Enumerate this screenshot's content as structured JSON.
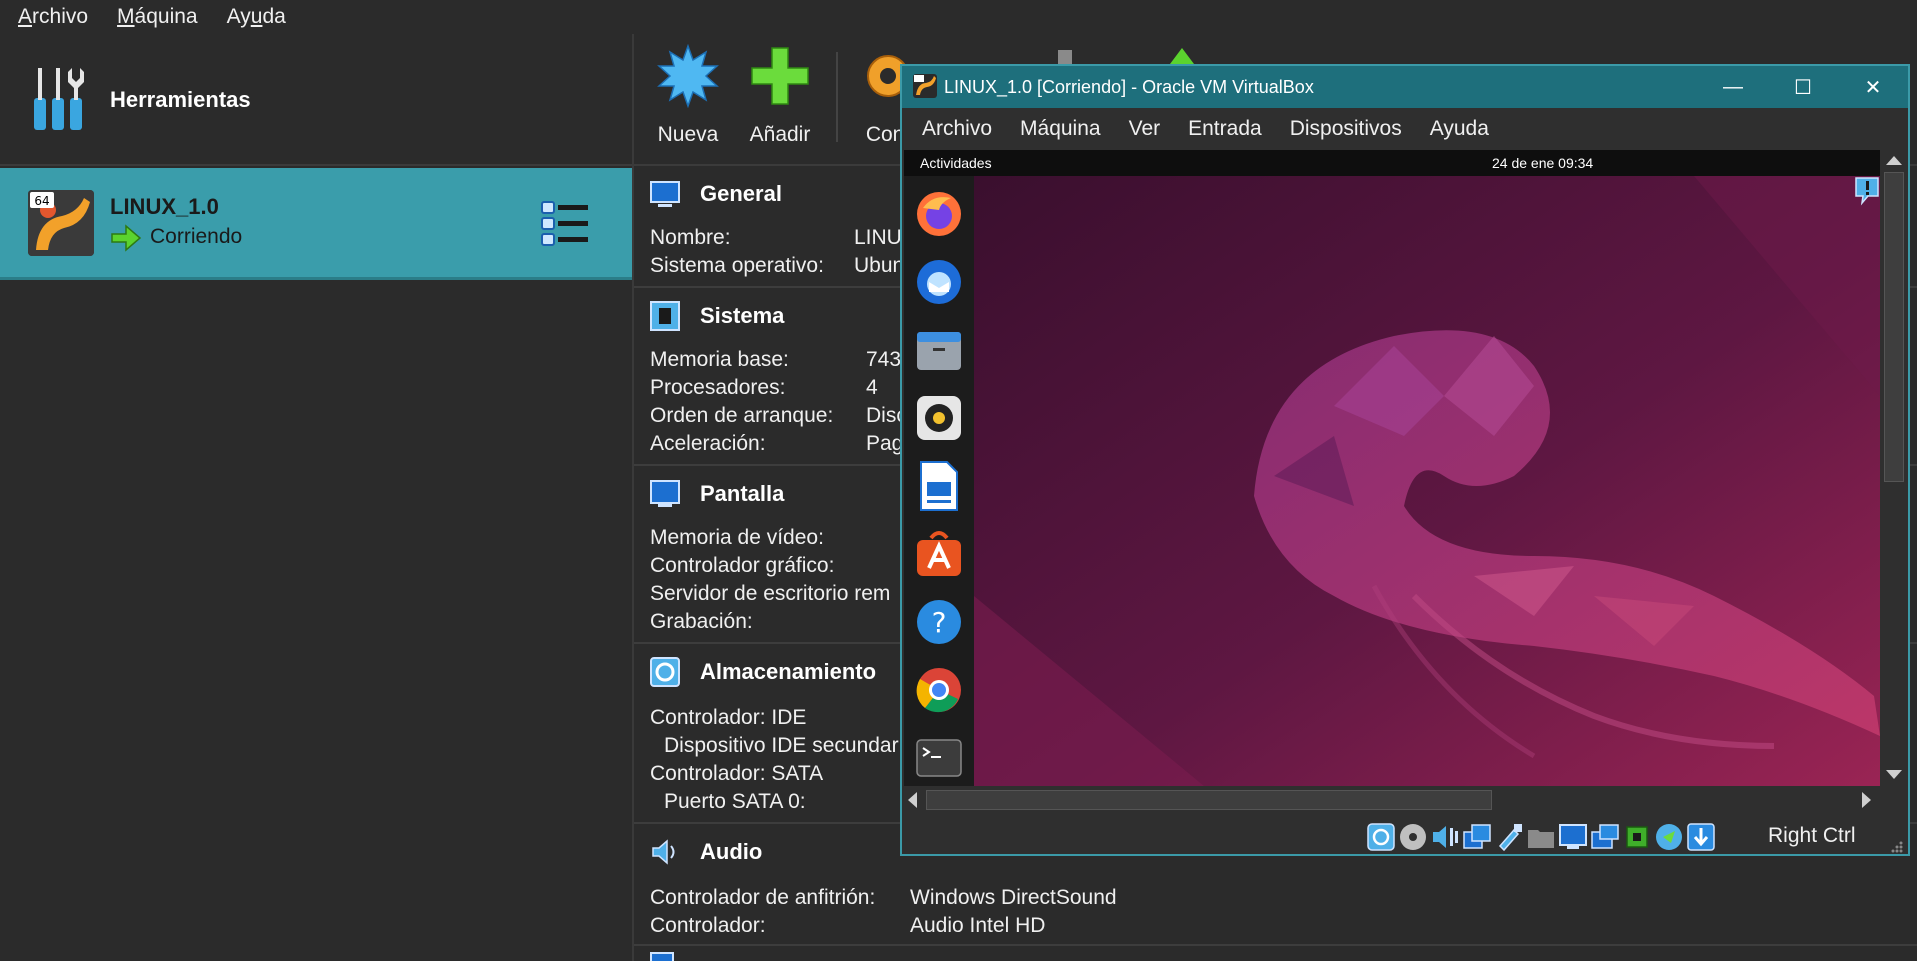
{
  "menubar": {
    "items": [
      {
        "label_pre": "",
        "label_ul": "A",
        "label_post": "rchivo"
      },
      {
        "label_pre": "",
        "label_ul": "M",
        "label_post": "áquina"
      },
      {
        "label_pre": "Ay",
        "label_ul": "u",
        "label_post": "da"
      }
    ]
  },
  "tools": {
    "label": "Herramientas",
    "icon": "tools-icon"
  },
  "vm": {
    "name": "LINUX_1.0",
    "status": "Corriendo",
    "badge": "64",
    "icon": "ubuntu-64-icon"
  },
  "toolbar": {
    "buttons": [
      {
        "label": "Nueva",
        "icon": "new-starburst-icon"
      },
      {
        "label": "Añadir",
        "icon": "add-plus-icon"
      },
      {
        "label": "Conf",
        "icon": "settings-gear-icon"
      }
    ]
  },
  "details": {
    "general": {
      "title": "General",
      "rows": [
        {
          "key": "Nombre:",
          "value": "LINU"
        },
        {
          "key": "Sistema operativo:",
          "value": "Ubun"
        }
      ]
    },
    "sistema": {
      "title": "Sistema",
      "rows": [
        {
          "key": "Memoria base:",
          "value": "743"
        },
        {
          "key": "Procesadores:",
          "value": "4"
        },
        {
          "key": "Orden de arranque:",
          "value": "Disc"
        },
        {
          "key": "Aceleración:",
          "value": "Pag"
        }
      ]
    },
    "pantalla": {
      "title": "Pantalla",
      "rows": [
        {
          "key": "Memoria de vídeo:"
        },
        {
          "key": "Controlador gráfico:"
        },
        {
          "key": "Servidor de escritorio rem"
        },
        {
          "key": "Grabación:"
        }
      ]
    },
    "almacenamiento": {
      "title": "Almacenamiento",
      "rows": [
        {
          "key": "Controlador: IDE"
        },
        {
          "key": "  Dispositivo IDE secundar"
        },
        {
          "key": "Controlador: SATA"
        },
        {
          "key": "  Puerto SATA 0:"
        }
      ]
    },
    "audio": {
      "title": "Audio",
      "rows": [
        {
          "key": "Controlador de anfitrión:",
          "value": "Windows DirectSound"
        },
        {
          "key": "Controlador:",
          "value": "Audio Intel HD"
        }
      ]
    }
  },
  "vmwindow": {
    "title": "LINUX_1.0 [Corriendo] - Oracle VM VirtualBox",
    "controls": {
      "minimize": "—",
      "maximize": "☐",
      "close": "✕"
    },
    "menu": [
      "Archivo",
      "Máquina",
      "Ver",
      "Entrada",
      "Dispositivos",
      "Ayuda"
    ],
    "guest": {
      "activities": "Actividades",
      "clock": "24 de ene  09:34",
      "dock_apps": [
        "firefox-icon",
        "thunderbird-icon",
        "files-icon",
        "rhythmbox-icon",
        "libreoffice-writer-icon",
        "app-center-icon",
        "help-icon",
        "chrome-icon",
        "terminal-icon"
      ]
    },
    "status_icons": [
      "hard-disk-icon",
      "optical-disk-icon",
      "audio-icon",
      "network-icon",
      "usb-icon",
      "shared-folder-icon",
      "display-icon",
      "capture-icon",
      "cpu-icon",
      "mouse-integration-icon",
      "keyboard-icon"
    ],
    "host_key": "Right Ctrl"
  },
  "colors": {
    "accent": "#3a9dab",
    "titlebar": "#1e6f7c",
    "background": "#2b2b2b",
    "wallpaper_dark": "#3a0f2e",
    "wallpaper_light": "#9a2454"
  }
}
